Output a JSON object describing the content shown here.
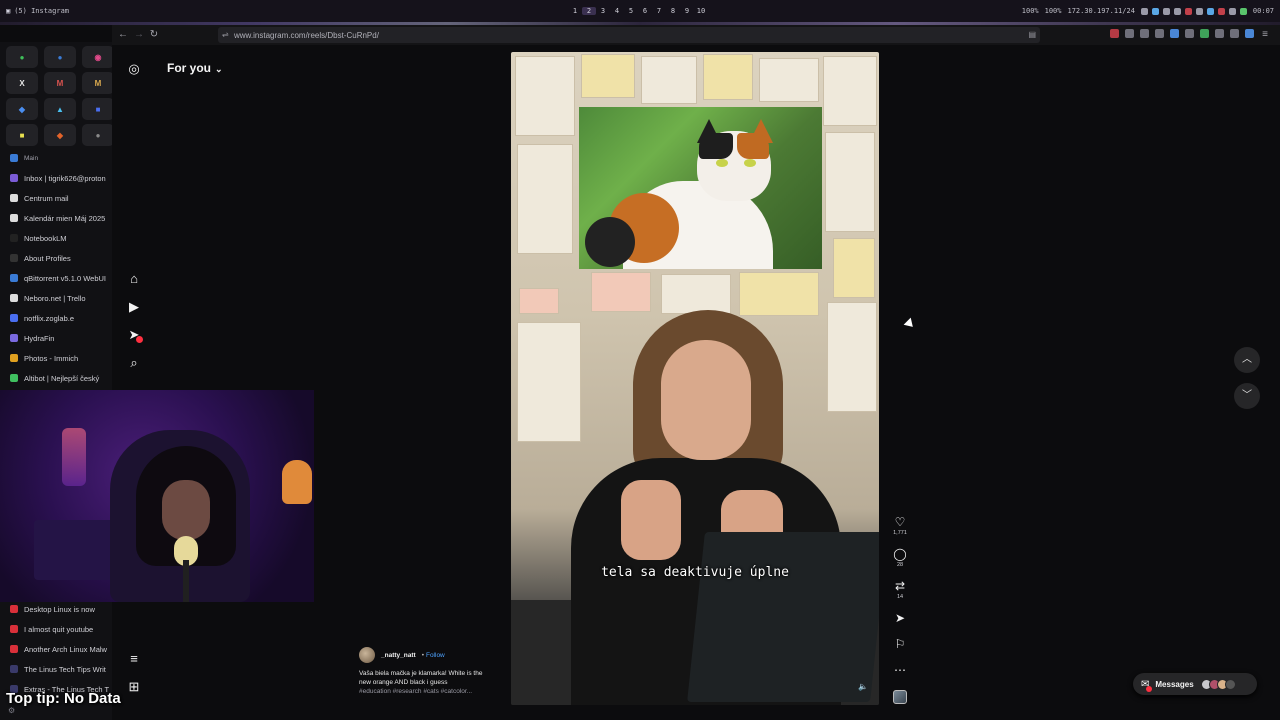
{
  "system_bar": {
    "app_title": "(5) Instagram",
    "workspaces": [
      "1",
      "2",
      "3",
      "4",
      "5",
      "6",
      "7",
      "8",
      "9",
      "10"
    ],
    "active_workspace": "2",
    "volume": "100%",
    "brightness": "100%",
    "ip": "172.30.197.11/24",
    "clock": "00:07"
  },
  "browser": {
    "url": "www.instagram.com/reels/Dbst-CuRnPd/"
  },
  "sidebar": {
    "pinned": [
      {
        "icon": "whatsapp-icon",
        "glyph": "●",
        "color": "#3fbf5a"
      },
      {
        "icon": "messenger-icon",
        "glyph": "●",
        "color": "#3a7bd5"
      },
      {
        "icon": "instagram-icon",
        "glyph": "◉",
        "color": "#e14a8a"
      },
      {
        "icon": "x-icon",
        "glyph": "X",
        "color": "#e6e6e6"
      },
      {
        "icon": "gmail-icon",
        "glyph": "M",
        "color": "#d9534f"
      },
      {
        "icon": "gmail-alt-icon",
        "glyph": "M",
        "color": "#d9a94f"
      },
      {
        "icon": "chat-icon",
        "glyph": "◆",
        "color": "#4a8ef0"
      },
      {
        "icon": "drop-icon",
        "glyph": "▲",
        "color": "#4ac0f0"
      },
      {
        "icon": "app-icon",
        "glyph": "■",
        "color": "#4a6ef0"
      },
      {
        "icon": "notes-icon",
        "glyph": "■",
        "color": "#e8e050"
      },
      {
        "icon": "gitlab-icon",
        "glyph": "◆",
        "color": "#e2632a"
      },
      {
        "icon": "circle-icon",
        "glyph": "●",
        "color": "#8a8a8a"
      }
    ],
    "items": [
      {
        "label": "Main",
        "color": "#3a7bd5",
        "section": true
      },
      {
        "label": "Inbox | tigrik626@proton",
        "color": "#7b5cd6"
      },
      {
        "label": "Centrum mail",
        "color": "#dddddd"
      },
      {
        "label": "Kalendár mien Máj 2025",
        "color": "#dddddd"
      },
      {
        "label": "NotebookLM",
        "color": "#222222"
      },
      {
        "label": "About Profiles",
        "color": "#333333"
      },
      {
        "label": "qBittorrent v5.1.0 WebUI",
        "color": "#3a7bd5"
      },
      {
        "label": "Neboro.net | Trello",
        "color": "#dddddd"
      },
      {
        "label": "notflix.zoglab.e",
        "color": "#4a6ef0"
      },
      {
        "label": "HydraFin",
        "color": "#7a6ae0"
      },
      {
        "label": "Photos - Immich",
        "color": "#e0a020"
      },
      {
        "label": "Altibot | Nejlepší český",
        "color": "#40c060"
      }
    ],
    "lower_items": [
      {
        "label": "Desktop Linux is now",
        "color": "#d9303a"
      },
      {
        "label": "I almost quit youtube",
        "color": "#d9303a"
      },
      {
        "label": "Another Arch Linux Malw",
        "color": "#d9303a"
      },
      {
        "label": "The Linus Tech Tips Writ",
        "color": "#3a3a6a"
      },
      {
        "label": "Extras - The Linus Tech T",
        "color": "#3a3a6a"
      }
    ]
  },
  "overlay": {
    "tip": "Top tip: No Data"
  },
  "instagram": {
    "feed_label": "For you",
    "reel": {
      "subtitle": "tela sa deaktivuje úplne",
      "username": "_natty_natt",
      "follow_label": "Follow",
      "caption_line1": "Vaša biela mačka je klamarka! White is the",
      "caption_line2": "new orange AND black i guess",
      "hashtags": "#education #research #cats #catcolor...",
      "likes": "1,771",
      "comments": "28",
      "reposts": "14"
    },
    "messages_label": "Messages"
  }
}
